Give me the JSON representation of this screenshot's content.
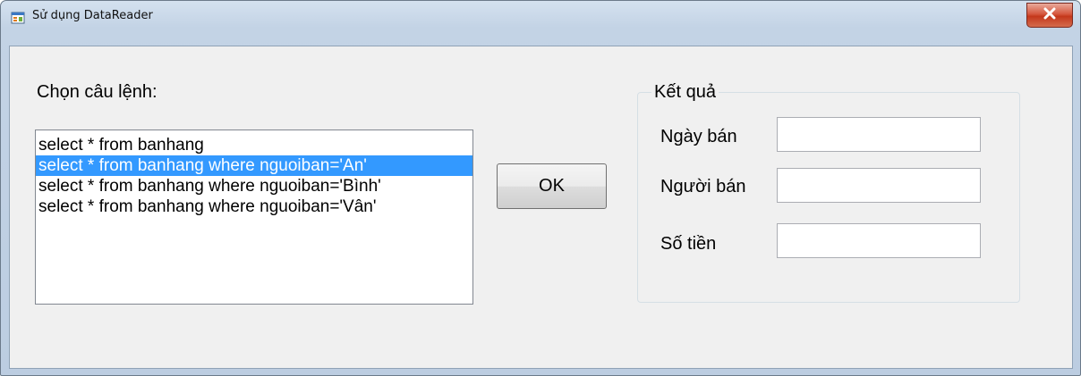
{
  "window": {
    "title": "Sử dụng DataReader",
    "close_symbol": "×"
  },
  "main": {
    "select_label": "Chọn câu lệnh:",
    "queries": [
      "select * from banhang",
      "select * from banhang where nguoiban='An'",
      "select * from banhang where nguoiban='Bình'",
      "select * from banhang where nguoiban='Vân'"
    ],
    "selected_index": 1,
    "ok_label": "OK"
  },
  "results": {
    "group_title": "Kết quả",
    "fields": [
      {
        "label": "Ngày bán",
        "value": ""
      },
      {
        "label": "Người bán",
        "value": ""
      },
      {
        "label": "Số tiền",
        "value": ""
      }
    ]
  },
  "colors": {
    "selection": "#3399ff",
    "close_button": "#c4381c"
  }
}
